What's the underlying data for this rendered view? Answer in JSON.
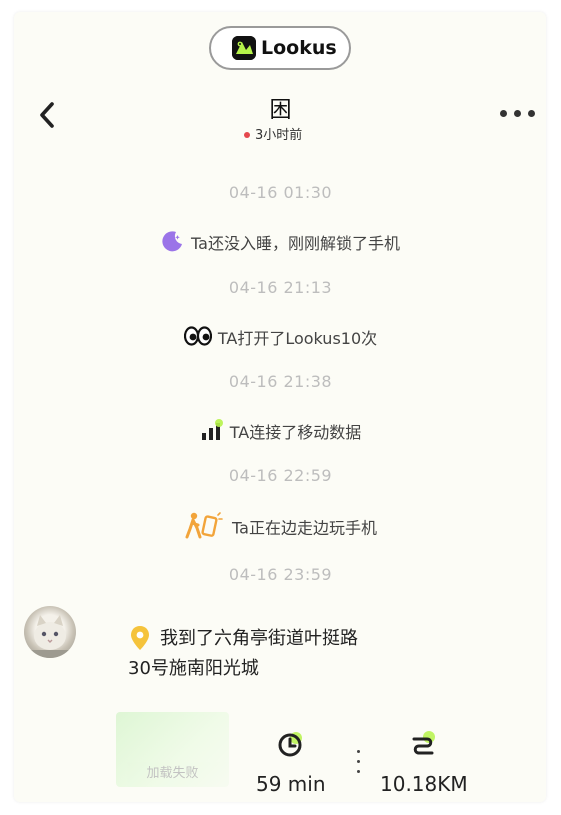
{
  "header": {
    "app_name": "Lookus",
    "title": "困",
    "status_text": "3小时前"
  },
  "timeline": [
    {
      "time": "04-16 01:30",
      "text": "Ta还没入睡，刚刚解锁了手机",
      "icon": "moon-icon"
    },
    {
      "time": "04-16 21:13",
      "text": "TA打开了Lookus10次",
      "icon": "eyes-icon"
    },
    {
      "time": "04-16 21:38",
      "text": "TA连接了移动数据",
      "icon": "signal-icon"
    },
    {
      "time": "04-16 22:59",
      "text": "Ta正在边走边玩手机",
      "icon": "walking-phone-icon"
    },
    {
      "time": "04-16 23:59"
    }
  ],
  "location": {
    "line1": "我到了六角亭街道叶挺路",
    "line2": "30号施南阳光城",
    "map_error": "加载失败"
  },
  "stats": {
    "duration": "59 min",
    "distance": "10.18KM"
  },
  "colors": {
    "accent_green": "#b6f34a",
    "moon_purple": "#9b74e8",
    "walk_orange": "#f2a43a",
    "pin_yellow": "#f5c33b",
    "status_red": "#e5484d"
  }
}
